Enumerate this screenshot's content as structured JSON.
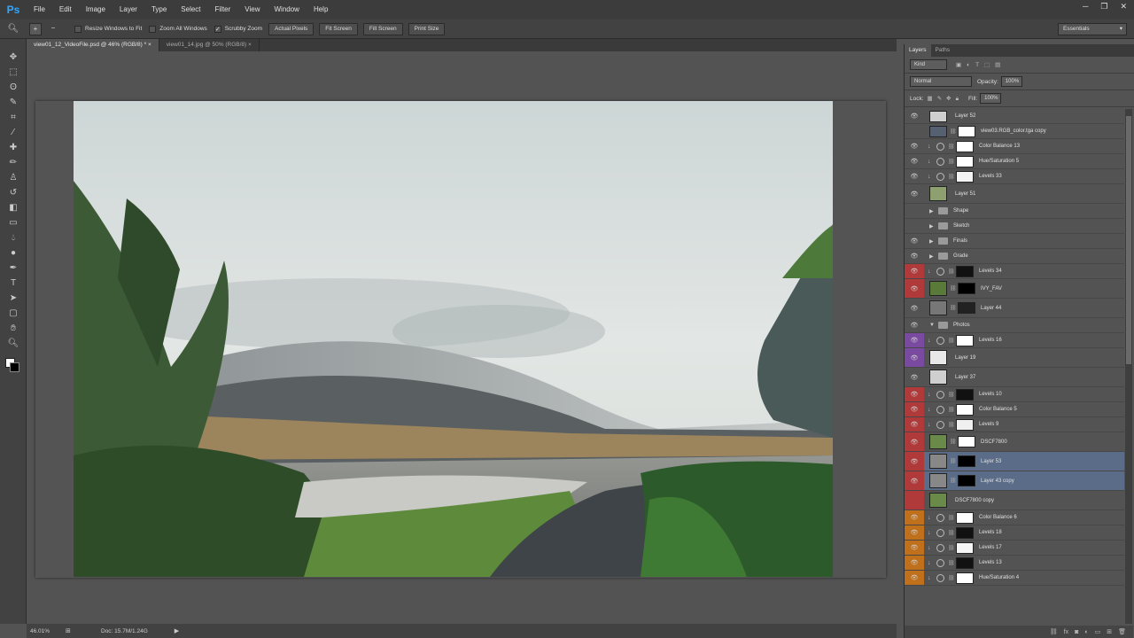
{
  "app": {
    "logo": "Ps"
  },
  "menu": [
    "File",
    "Edit",
    "Image",
    "Layer",
    "Type",
    "Select",
    "Filter",
    "View",
    "Window",
    "Help"
  ],
  "options": {
    "resize_windows": "Resize Windows to Fit",
    "zoom_all": "Zoom All Windows",
    "scrubby": "Scrubby Zoom",
    "btn_actual": "Actual Pixels",
    "btn_fit": "Fit Screen",
    "btn_fill": "Fill Screen",
    "btn_print": "Print Size",
    "workspace": "Essentials"
  },
  "tabs": [
    {
      "label": "view01_12_VideoFile.psd @ 46% (RGB/8) *",
      "close": "×"
    },
    {
      "label": "view01_14.jpg @ 50% (RGB/8)",
      "close": "×"
    }
  ],
  "status": {
    "zoom": "46.01%",
    "doc": "Doc: 15.7M/1.24G"
  },
  "layers_panel": {
    "tab_layers": "Layers",
    "tab_paths": "Paths",
    "kind": "Kind",
    "blend": "Normal",
    "opacity_label": "Opacity:",
    "opacity": "100%",
    "lock_label": "Lock:",
    "fill_label": "Fill:",
    "fill": "100%"
  },
  "layers": [
    {
      "name": "Layer 52",
      "eye": true,
      "type": "pixel",
      "thumb": "#cfcfcf"
    },
    {
      "name": "view03.RGB_color.tga copy",
      "eye": false,
      "type": "pixelmask",
      "thumb": "#556070",
      "mask": "#ffffff"
    },
    {
      "name": "Color Balance 13",
      "eye": true,
      "type": "adj",
      "clip": true,
      "mask": "#ffffff"
    },
    {
      "name": "Hue/Saturation 5",
      "eye": true,
      "type": "adj",
      "clip": true,
      "mask": "#ffffff"
    },
    {
      "name": "Levels 33",
      "eye": true,
      "type": "adj",
      "clip": true,
      "mask": "#f4f4f4"
    },
    {
      "name": "Layer 51",
      "eye": true,
      "type": "pixel",
      "thumb": "#8fa070",
      "tall": true
    },
    {
      "name": "Shape",
      "eye": false,
      "type": "group"
    },
    {
      "name": "Sketch",
      "eye": false,
      "type": "group"
    },
    {
      "name": "Finals",
      "eye": true,
      "type": "group"
    },
    {
      "name": "Grade",
      "eye": true,
      "type": "group"
    },
    {
      "name": "Levels 34",
      "eye": true,
      "type": "adj",
      "color": "#b03a3a",
      "clip": true,
      "mask": "#111111"
    },
    {
      "name": "IVY_FAV",
      "eye": true,
      "type": "pixelmask",
      "color": "#b03a3a",
      "thumb": "#5a7a3a",
      "mask": "#000000",
      "tall": true
    },
    {
      "name": "Layer 44",
      "eye": true,
      "type": "pixelmask",
      "thumb": "#777777",
      "mask": "#222222",
      "tall": true
    },
    {
      "name": "Photos",
      "eye": true,
      "type": "group",
      "open": true
    },
    {
      "name": "Levels 16",
      "eye": true,
      "type": "adj",
      "color": "#7a4aa0",
      "clip": true,
      "mask": "#ffffff"
    },
    {
      "name": "Layer 19",
      "eye": true,
      "type": "pixel",
      "color": "#7a4aa0",
      "thumb": "#e8e8e8",
      "tall": true
    },
    {
      "name": "Layer 37",
      "eye": true,
      "type": "pixel",
      "thumb": "#cfcfcf",
      "tall": true
    },
    {
      "name": "Levels 10",
      "eye": true,
      "type": "adj",
      "color": "#b03a3a",
      "clip": true,
      "mask": "#111111"
    },
    {
      "name": "Color Balance 5",
      "eye": true,
      "type": "adj",
      "color": "#b03a3a",
      "clip": true,
      "mask": "#ffffff"
    },
    {
      "name": "Levels 9",
      "eye": true,
      "type": "adj",
      "color": "#b03a3a",
      "clip": true,
      "mask": "#f0f0f0"
    },
    {
      "name": "DSCF7800",
      "eye": true,
      "type": "pixelmask",
      "color": "#b03a3a",
      "thumb": "#6a8a4a",
      "mask": "#ffffff",
      "tall": true
    },
    {
      "name": "Layer 53",
      "eye": true,
      "type": "pixelmask",
      "color": "#b03a3a",
      "thumb": "#888888",
      "mask": "#000000",
      "sel": true,
      "tall": true
    },
    {
      "name": "Layer 43 copy",
      "eye": true,
      "type": "pixelmask",
      "color": "#b03a3a",
      "thumb": "#888888",
      "mask": "#000000",
      "sel": true,
      "tall": true
    },
    {
      "name": "DSCF7800 copy",
      "eye": false,
      "type": "pixel",
      "color": "#b03a3a",
      "thumb": "#6a8a4a",
      "tall": true
    },
    {
      "name": "Color Balance 6",
      "eye": true,
      "type": "adj",
      "color": "#c0701a",
      "clip": true,
      "mask": "#ffffff"
    },
    {
      "name": "Levels 18",
      "eye": true,
      "type": "adj",
      "color": "#c0701a",
      "clip": true,
      "mask": "#111111"
    },
    {
      "name": "Levels 17",
      "eye": true,
      "type": "adj",
      "color": "#c0701a",
      "clip": true,
      "mask": "#f6f6f6"
    },
    {
      "name": "Levels 13",
      "eye": true,
      "type": "adj",
      "color": "#c0701a",
      "clip": true,
      "mask": "#111111"
    },
    {
      "name": "Hue/Saturation 4",
      "eye": true,
      "type": "adj",
      "color": "#c0701a",
      "clip": true,
      "mask": "#ffffff"
    }
  ],
  "tools": [
    "move-tool-icon",
    "marquee-tool-icon",
    "lasso-tool-icon",
    "quick-select-tool-icon",
    "crop-tool-icon",
    "eyedropper-tool-icon",
    "healing-brush-tool-icon",
    "brush-tool-icon",
    "clone-stamp-tool-icon",
    "history-brush-tool-icon",
    "eraser-tool-icon",
    "gradient-tool-icon",
    "blur-tool-icon",
    "dodge-tool-icon",
    "pen-tool-icon",
    "type-tool-icon",
    "path-select-tool-icon",
    "rectangle-tool-icon",
    "hand-tool-icon",
    "zoom-tool-icon"
  ]
}
